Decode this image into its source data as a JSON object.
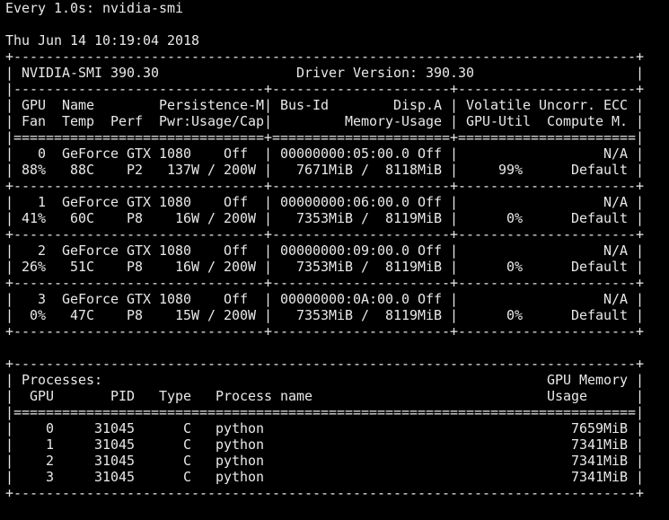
{
  "terminal": {
    "watch_header": "Every 1.0s: nvidia-smi",
    "timestamp": "Thu Jun 14 10:19:04 2018"
  },
  "nvidia_smi": {
    "version_line": "| NVIDIA-SMI 390.30                 Driver Version: 390.30                    |",
    "border_top": "+-----------------------------------------------------------------------------+",
    "divider": "|-------------------------------+----------------------+----------------------+",
    "header_line_1": "| GPU  Name        Persistence-M| Bus-Id        Disp.A | Volatile Uncorr. ECC |",
    "header_line_2": "| Fan  Temp  Perf  Pwr:Usage/Cap|         Memory-Usage | GPU-Util  Compute M. |",
    "double_divider": "|===============================+======================+======================|",
    "row_sep": "+-------------------------------+----------------------+----------------------+",
    "gpus": [
      {
        "line1": "|   0  GeForce GTX 1080    Off  | 00000000:05:00.0 Off |                  N/A |",
        "line2": "| 88%   88C    P2   137W / 200W |   7671MiB /  8118MiB |     99%      Default |"
      },
      {
        "line1": "|   1  GeForce GTX 1080    Off  | 00000000:06:00.0 Off |                  N/A |",
        "line2": "| 41%   60C    P8    16W / 200W |   7353MiB /  8119MiB |      0%      Default |"
      },
      {
        "line1": "|   2  GeForce GTX 1080    Off  | 00000000:09:00.0 Off |                  N/A |",
        "line2": "| 26%   51C    P8    16W / 200W |   7353MiB /  8119MiB |      0%      Default |"
      },
      {
        "line1": "|   3  GeForce GTX 1080    Off  | 00000000:0A:00.0 Off |                  N/A |",
        "line2": "|  0%   47C    P8    15W / 200W |   7353MiB /  8119MiB |      0%      Default |"
      }
    ]
  },
  "processes": {
    "border_top": "+-----------------------------------------------------------------------------+",
    "header_line_1": "| Processes:                                                       GPU Memory |",
    "header_line_2": "|  GPU       PID   Type   Process name                             Usage      |",
    "double_divider": "|=============================================================================|",
    "rows": [
      "|    0     31045      C   python                                      7659MiB |",
      "|    1     31045      C   python                                      7341MiB |",
      "|    2     31045      C   python                                      7341MiB |",
      "|    3     31045      C   python                                      7341MiB |"
    ],
    "border_bottom": "+-----------------------------------------------------------------------------+"
  }
}
